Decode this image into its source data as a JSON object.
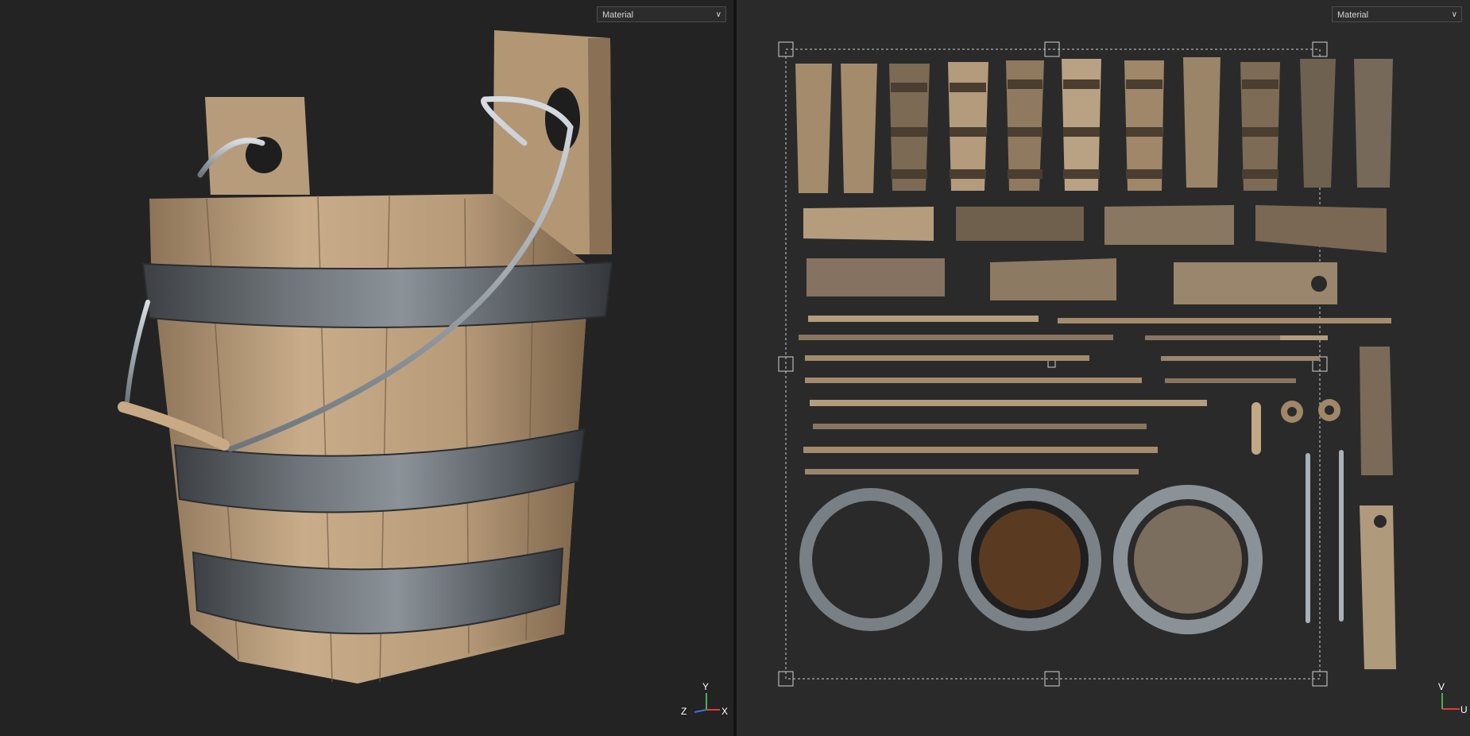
{
  "viewports": {
    "model": {
      "material_dropdown": {
        "value": "Material"
      },
      "axis_gizmo": {
        "y": "Y",
        "z": "Z",
        "x": "X"
      }
    },
    "uv": {
      "material_dropdown": {
        "value": "Material"
      },
      "axis_gizmo": {
        "v": "V",
        "u": "U"
      }
    }
  },
  "colors": {
    "background": "#232323",
    "uv_background": "#2a2a2a",
    "wood_light": "#c4a885",
    "wood_dark": "#8a7256",
    "metal": "#5a6066",
    "metal_highlight": "#9aa3aa",
    "selection": "#d0d0d0"
  },
  "icons": {
    "dropdown": "chevron-down-icon",
    "gizmo_3d": "xyz-axis-gizmo-icon",
    "gizmo_uv": "uv-axis-gizmo-icon"
  }
}
